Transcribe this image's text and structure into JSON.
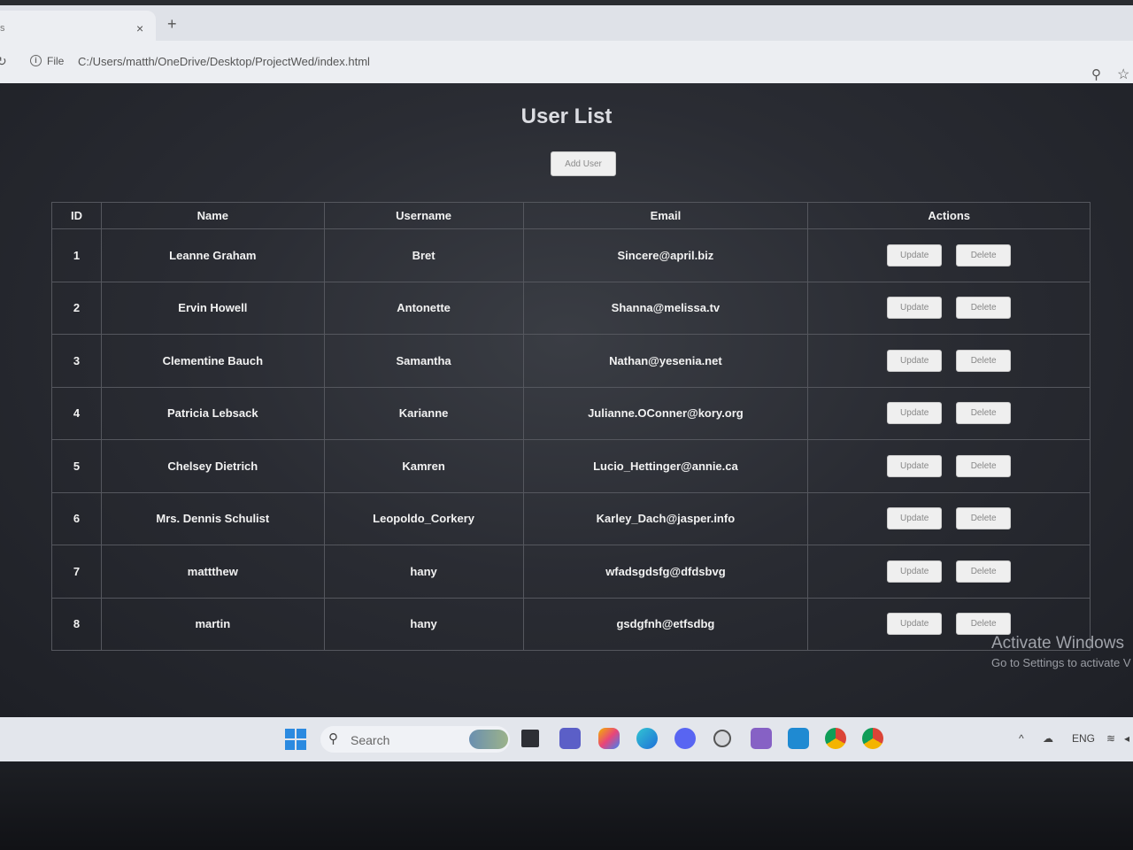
{
  "browser": {
    "tab_left_glyph": "s",
    "tab_close": "×",
    "new_tab": "+",
    "file_label": "File",
    "address": "C:/Users/matth/OneDrive/Desktop/ProjectWed/index.html"
  },
  "page": {
    "title": "User List",
    "add_button": "Add User"
  },
  "table": {
    "headers": [
      "ID",
      "Name",
      "Username",
      "Email",
      "Actions"
    ],
    "rows": [
      {
        "id": "1",
        "name": "Leanne Graham",
        "username": "Bret",
        "email": "Sincere@april.biz"
      },
      {
        "id": "2",
        "name": "Ervin Howell",
        "username": "Antonette",
        "email": "Shanna@melissa.tv"
      },
      {
        "id": "3",
        "name": "Clementine Bauch",
        "username": "Samantha",
        "email": "Nathan@yesenia.net"
      },
      {
        "id": "4",
        "name": "Patricia Lebsack",
        "username": "Karianne",
        "email": "Julianne.OConner@kory.org"
      },
      {
        "id": "5",
        "name": "Chelsey Dietrich",
        "username": "Kamren",
        "email": "Lucio_Hettinger@annie.ca"
      },
      {
        "id": "6",
        "name": "Mrs. Dennis Schulist",
        "username": "Leopoldo_Corkery",
        "email": "Karley_Dach@jasper.info"
      },
      {
        "id": "7",
        "name": "mattthew",
        "username": "hany",
        "email": "wfadsgdsfg@dfdsbvg"
      },
      {
        "id": "8",
        "name": "martin",
        "username": "hany",
        "email": "gsdgfnh@etfsdbg"
      }
    ],
    "update_label": "Update",
    "delete_label": "Delete"
  },
  "watermark": {
    "title": "Activate Windows",
    "subtitle": "Go to Settings to activate V"
  },
  "taskbar": {
    "search_placeholder": "Search",
    "language": "ENG",
    "icons": [
      "windows-start",
      "widgets",
      "task-view",
      "teams",
      "copilot",
      "edge",
      "discord",
      "chatgpt",
      "visual-studio",
      "vscode",
      "chrome",
      "chrome-profile"
    ]
  }
}
